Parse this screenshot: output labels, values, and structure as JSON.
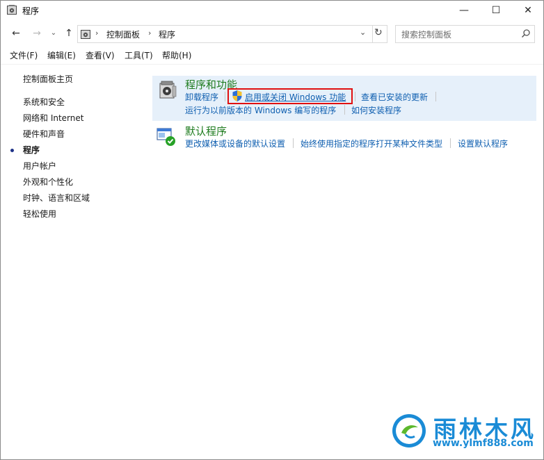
{
  "window": {
    "title": "程序",
    "controls": {
      "minimize": "—",
      "maximize": "☐",
      "close": "✕"
    }
  },
  "nav": {
    "back": "←",
    "forward": "→",
    "recent": "⌄",
    "up": "↑",
    "address": {
      "breadcrumbs": [
        "控制面板",
        "程序"
      ],
      "separator": "›"
    },
    "dropdown": "⌄",
    "refresh": "↻",
    "search": {
      "placeholder": "搜索控制面板"
    }
  },
  "menu": [
    "文件(F)",
    "编辑(E)",
    "查看(V)",
    "工具(T)",
    "帮助(H)"
  ],
  "sidebar": {
    "items": [
      {
        "label": "控制面板主页"
      },
      {
        "label": "系统和安全"
      },
      {
        "label": "网络和 Internet"
      },
      {
        "label": "硬件和声音"
      },
      {
        "label": "程序",
        "active": true
      },
      {
        "label": "用户帐户"
      },
      {
        "label": "外观和个性化"
      },
      {
        "label": "时钟、语言和区域"
      },
      {
        "label": "轻松使用"
      }
    ]
  },
  "categories": [
    {
      "title": "程序和功能",
      "icon": "programs-and-features-icon",
      "links": [
        "卸载程序",
        "启用或关闭 Windows 功能",
        "查看已安装的更新",
        "运行为以前版本的 Windows 编写的程序",
        "如何安装程序"
      ]
    },
    {
      "title": "默认程序",
      "icon": "default-programs-icon",
      "links": [
        "更改媒体或设备的默认设置",
        "始终使用指定的程序打开某种文件类型",
        "设置默认程序"
      ]
    }
  ],
  "watermark": {
    "title": "雨林木风",
    "url": "www.ylmf888.com"
  },
  "colors": {
    "link": "#0f5fb0",
    "category_title": "#1e7b1e",
    "highlight_bg": "#e6f0fa",
    "annotation_box": "#e01010",
    "watermark": "#1a8bd6"
  }
}
